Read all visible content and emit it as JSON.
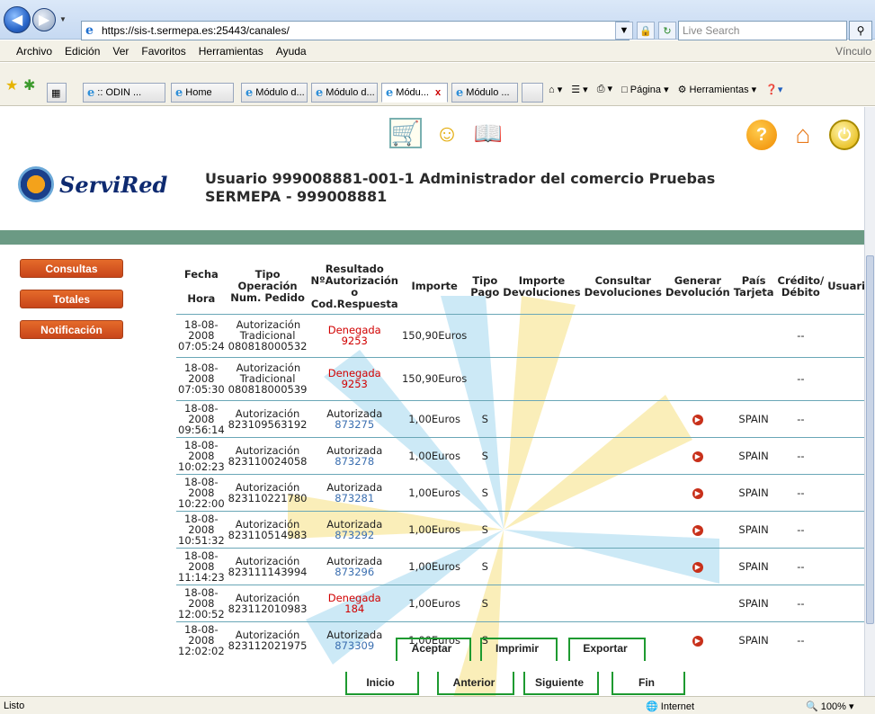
{
  "browser": {
    "url": "https://sis-t.sermepa.es:25443/canales/",
    "search_placeholder": "Live Search",
    "menu": [
      "Archivo",
      "Edición",
      "Ver",
      "Favoritos",
      "Herramientas",
      "Ayuda"
    ],
    "menu_right": "Vínculo",
    "tabs": [
      {
        "label": ":: ODIN ..."
      },
      {
        "label": "Home"
      },
      {
        "label": "Módulo d..."
      },
      {
        "label": "Módulo d..."
      },
      {
        "label": "Módu..."
      },
      {
        "label": "Módulo ..."
      }
    ],
    "cmd_pagina": "Página",
    "cmd_herramientas": "Herramientas",
    "status_text": "Listo",
    "status_zone": "Internet",
    "status_zoom": "100%"
  },
  "page": {
    "logo_text": "ServiRed",
    "user_line1": "Usuario 999008881-001-1   Administrador del comercio   Pruebas",
    "user_line2": "SERMEPA - 999008881",
    "side_buttons": [
      "Consultas",
      "Totales",
      "Notificación"
    ],
    "headers": {
      "fecha": "Fecha",
      "hora": "Hora",
      "tipo_op": "Tipo Operación",
      "num_pedido": "Num. Pedido",
      "resultado": "Resultado",
      "num_autorizacion": "NºAutorización",
      "o": "o",
      "cod_respuesta": "Cod.Respuesta",
      "importe": "Importe",
      "tipo_pago": "Tipo Pago",
      "importe_dev": "Importe Devoluciones",
      "consultar_dev": "Consultar Devoluciones",
      "generar_dev": "Generar Devolución",
      "pais": "País Tarjeta",
      "credito": "Crédito/ Débito",
      "usuario": "Usuario"
    },
    "rows": [
      {
        "fecha": "18-08-2008",
        "hora": "07:05:24",
        "tipo": "Autorización Tradicional",
        "pedido": "080818000532",
        "resultado": "Denegada",
        "codigo": "9253",
        "importe": "150,90Euros",
        "pago": "",
        "pais": "",
        "credito": "--",
        "generar": false
      },
      {
        "fecha": "18-08-2008",
        "hora": "07:05:30",
        "tipo": "Autorización Tradicional",
        "pedido": "080818000539",
        "resultado": "Denegada",
        "codigo": "9253",
        "importe": "150,90Euros",
        "pago": "",
        "pais": "",
        "credito": "--",
        "generar": false
      },
      {
        "fecha": "18-08-2008",
        "hora": "09:56:14",
        "tipo": "Autorización",
        "pedido": "823109563192",
        "resultado": "Autorizada",
        "codigo": "873275",
        "importe": "1,00Euros",
        "pago": "S",
        "pais": "SPAIN",
        "credito": "--",
        "generar": true
      },
      {
        "fecha": "18-08-2008",
        "hora": "10:02:23",
        "tipo": "Autorización",
        "pedido": "823110024058",
        "resultado": "Autorizada",
        "codigo": "873278",
        "importe": "1,00Euros",
        "pago": "S",
        "pais": "SPAIN",
        "credito": "--",
        "generar": true
      },
      {
        "fecha": "18-08-2008",
        "hora": "10:22:00",
        "tipo": "Autorización",
        "pedido": "823110221780",
        "resultado": "Autorizada",
        "codigo": "873281",
        "importe": "1,00Euros",
        "pago": "S",
        "pais": "SPAIN",
        "credito": "--",
        "generar": true
      },
      {
        "fecha": "18-08-2008",
        "hora": "10:51:32",
        "tipo": "Autorización",
        "pedido": "823110514983",
        "resultado": "Autorizada",
        "codigo": "873292",
        "importe": "1,00Euros",
        "pago": "S",
        "pais": "SPAIN",
        "credito": "--",
        "generar": true
      },
      {
        "fecha": "18-08-2008",
        "hora": "11:14:23",
        "tipo": "Autorización",
        "pedido": "823111143994",
        "resultado": "Autorizada",
        "codigo": "873296",
        "importe": "1,00Euros",
        "pago": "S",
        "pais": "SPAIN",
        "credito": "--",
        "generar": true
      },
      {
        "fecha": "18-08-2008",
        "hora": "12:00:52",
        "tipo": "Autorización",
        "pedido": "823112010983",
        "resultado": "Denegada",
        "codigo": "184",
        "importe": "1,00Euros",
        "pago": "S",
        "pais": "SPAIN",
        "credito": "--",
        "generar": false
      },
      {
        "fecha": "18-08-2008",
        "hora": "12:02:02",
        "tipo": "Autorización",
        "pedido": "823112021975",
        "resultado": "Autorizada",
        "codigo": "873309",
        "importe": "1,00Euros",
        "pago": "S",
        "pais": "SPAIN",
        "credito": "--",
        "generar": true
      }
    ],
    "actions_top": [
      "Aceptar",
      "Imprimir",
      "Exportar"
    ],
    "actions_bottom": [
      "Inicio",
      "Anterior",
      "Siguiente",
      "Fin"
    ]
  },
  "colors": {
    "accent_orange": "#d4561f",
    "band_green": "#6b9a84",
    "denied_red": "#d10000",
    "code_blue": "#3b6fb0",
    "frame_green": "#1e9a30"
  }
}
